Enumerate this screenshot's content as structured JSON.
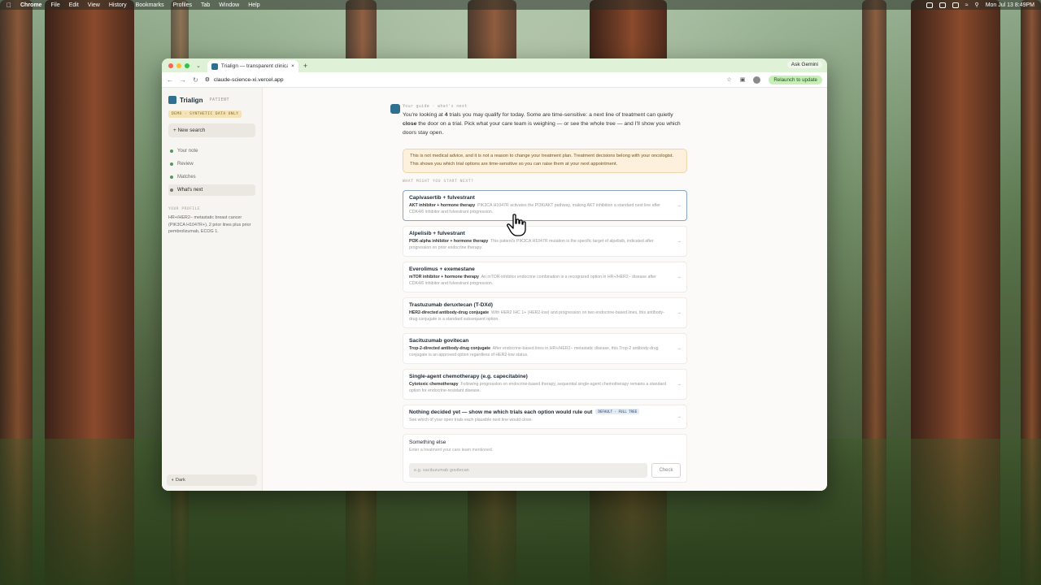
{
  "menubar": {
    "app": "Chrome",
    "items": [
      "File",
      "Edit",
      "View",
      "History",
      "Bookmarks",
      "Profiles",
      "Tab",
      "Window",
      "Help"
    ],
    "clock": "Mon Jul 13  8:49PM"
  },
  "browser": {
    "tab_title": "Trialign — transparent clinica",
    "url": "claude-science-xi.vercel.app",
    "ask_gemini": "Ask Gemini",
    "relaunch": "Relaunch to update"
  },
  "sidebar": {
    "brand": "Trialign",
    "tag": "PATIENT",
    "demo": "DEMO · SYNTHETIC DATA ONLY",
    "new_search": "+ New search",
    "nav": [
      {
        "label": "Your note"
      },
      {
        "label": "Review"
      },
      {
        "label": "Matches"
      },
      {
        "label": "What's next"
      }
    ],
    "profile_heading": "YOUR PROFILE",
    "profile_text": "HR+/HER2− metastatic breast cancer (PIK3CA H1047R+), 2 prior lines plus prior pembrolizumab, ECOG 1.",
    "dark_label": "◐ Dark"
  },
  "guide": {
    "heading": "Your guide · what's next",
    "text_pre": "You're looking at ",
    "count": "4",
    "text_mid": " trials you may qualify for today. Some are time-sensitive: a next line of treatment can quietly ",
    "close_word": "close",
    "text_post": " the door on a trial. Pick what your care team is weighing — or see the whole tree — and I'll show you which doors stay open."
  },
  "warning": "This is not medical advice, and it is not a reason to change your treatment plan. Treatment decisions belong with your oncologist. This shows you which trial options are time-sensitive so you can raise them at your next appointment.",
  "section_heading": "WHAT MIGHT YOU START NEXT?",
  "options": [
    {
      "name": "Capivasertib + fulvestrant",
      "class": "AKT inhibitor + hormone therapy",
      "desc": "PIK3CA H1047R activates the PI3K/AKT pathway, making AKT inhibition a standard next line after CDK4/6 inhibitor and fulvestrant progression."
    },
    {
      "name": "Alpelisib + fulvestrant",
      "class": "PI3K-alpha inhibitor + hormone therapy",
      "desc": "This patient's PIK3CA H1047R mutation is the specific target of alpelisib, indicated after progression on prior endocrine therapy."
    },
    {
      "name": "Everolimus + exemestane",
      "class": "mTOR inhibitor + hormone therapy",
      "desc": "An mTOR-inhibitor endocrine combination is a recognized option in HR+/HER2− disease after CDK4/6 inhibitor and fulvestrant progression."
    },
    {
      "name": "Trastuzumab deruxtecan (T-DXd)",
      "class": "HER2-directed antibody-drug conjugate",
      "desc": "With HER2 IHC 1+ (HER2-low) and progression on two endocrine-based lines, this antibody-drug conjugate is a standard subsequent option."
    },
    {
      "name": "Sacituzumab govitecan",
      "class": "Trop-2-directed antibody-drug conjugate",
      "desc": "After endocrine-based lines in HR+/HER2− metastatic disease, this Trop-2 antibody-drug conjugate is an approved option regardless of HER2-low status."
    },
    {
      "name": "Single-agent chemotherapy (e.g. capecitabine)",
      "class": "Cytotoxic chemotherapy",
      "desc": "Following progression on endocrine-based therapy, sequential single-agent chemotherapy remains a standard option for endocrine-resistant disease."
    }
  ],
  "default_option": {
    "name": "Nothing decided yet — show me which trials each option would rule out",
    "badge": "DEFAULT · FULL TREE",
    "desc": "See which of your open trials each plausible next line would close."
  },
  "something_else": {
    "title": "Something else",
    "sub": "Enter a treatment your care team mentioned.",
    "placeholder": "e.g. sacituzumab govitecan",
    "check": "Check"
  },
  "arrow": "→"
}
